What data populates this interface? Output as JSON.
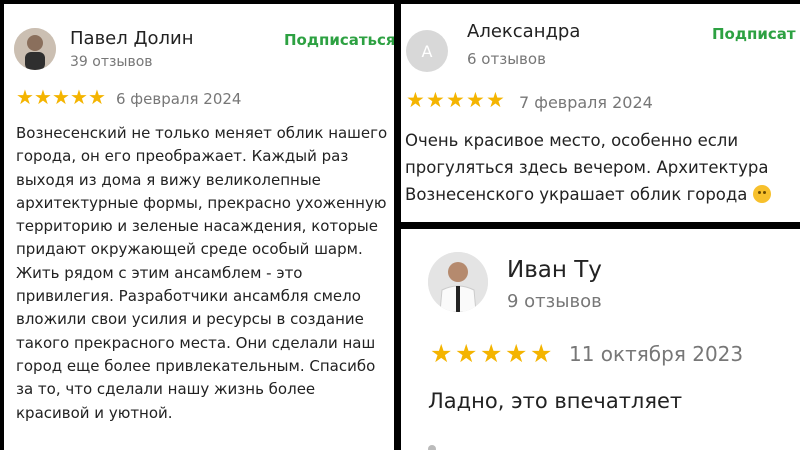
{
  "reviews": [
    {
      "author": "Павел Долин",
      "reviews_count": "39 отзывов",
      "subscribe_label": "Подписаться",
      "rating": 5,
      "date": "6 февраля 2024",
      "text": "Вознесенский не только меняет облик нашего города, он его преображает. Каждый раз выходя из дома я вижу великолепные архитектурные формы, прекрасно ухоженную территорию и зеленые насаждения, которые придают окружающей среде особый шарм. Жить рядом с этим ансамблем - это привилегия. Разработчики ансамбля смело вложили свои усилия и ресурсы в создание такого прекрасного места. Они сделали наш город еще более привлекательным. Спасибо за то, что сделали нашу жизнь более красивой и уютной."
    },
    {
      "author": "Александра",
      "avatar_letter": "А",
      "reviews_count": "6 отзывов",
      "subscribe_label": "Подписат",
      "rating": 5,
      "date": "7 февраля 2024",
      "text_lines": [
        "Очень красивое место, особенно если",
        "прогуляться здесь вечером. Архитектура",
        "Вознесенского украшает облик города"
      ],
      "emoji": "smiling-face-emoji"
    },
    {
      "author": "Иван Ту",
      "reviews_count": "9 отзывов",
      "rating": 5,
      "date": "11 октября 2023",
      "text": "Ладно, это впечатляет"
    }
  ],
  "colors": {
    "subscribe": "#2da142",
    "star": "#f4b400",
    "muted_text": "#777777",
    "background": "#000000"
  }
}
